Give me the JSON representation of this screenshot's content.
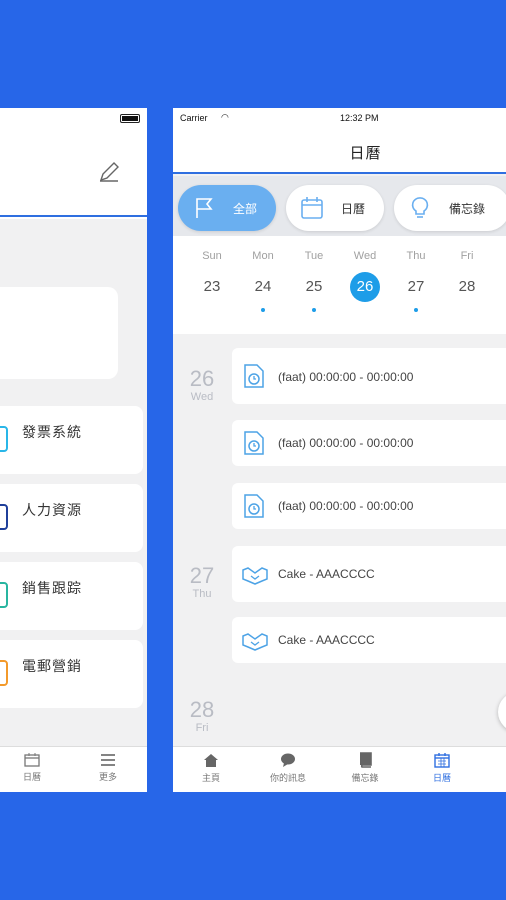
{
  "left_phone": {
    "menu_rows": [
      {
        "label": "發票系統",
        "icon": "invoice-icon",
        "color": "#29b6e8"
      },
      {
        "label": "人力資源",
        "icon": "hr-icon",
        "color": "#1f3f9a"
      },
      {
        "label": "銷售跟踪",
        "icon": "sales-icon",
        "color": "#28b5a0"
      },
      {
        "label": "電郵營銷",
        "icon": "email-icon",
        "color": "#f39a2b"
      }
    ],
    "tabs": [
      {
        "label": "日曆",
        "icon": "calendar-icon"
      },
      {
        "label": "更多",
        "icon": "menu-icon"
      }
    ]
  },
  "status_bar": {
    "carrier": "Carrier",
    "time": "12:32 PM"
  },
  "navbar": {
    "title": "日曆"
  },
  "filters": [
    {
      "label": "全部",
      "icon": "flag-icon",
      "active": true
    },
    {
      "label": "日曆",
      "icon": "calendar-icon",
      "active": false
    },
    {
      "label": "備忘錄",
      "icon": "lightbulb-icon",
      "active": false
    }
  ],
  "week": [
    {
      "name": "Sun",
      "date": "23",
      "dot": false,
      "selected": false
    },
    {
      "name": "Mon",
      "date": "24",
      "dot": true,
      "selected": false
    },
    {
      "name": "Tue",
      "date": "25",
      "dot": true,
      "selected": false
    },
    {
      "name": "Wed",
      "date": "26",
      "dot": true,
      "selected": true
    },
    {
      "name": "Thu",
      "date": "27",
      "dot": true,
      "selected": false
    },
    {
      "name": "Fri",
      "date": "28",
      "dot": false,
      "selected": false
    }
  ],
  "agenda": [
    {
      "date": "26",
      "weekday": "Wed"
    },
    {
      "date": "27",
      "weekday": "Thu"
    },
    {
      "date": "28",
      "weekday": "Fri"
    }
  ],
  "events": [
    {
      "text": "(faat) 00:00:00 - 00:00:00",
      "icon": "task-clock-icon"
    },
    {
      "text": "(faat) 00:00:00 - 00:00:00",
      "icon": "task-clock-icon"
    },
    {
      "text": "(faat) 00:00:00 - 00:00:00",
      "icon": "task-clock-icon"
    },
    {
      "text": "Cake - AAACCCC",
      "icon": "handshake-icon"
    },
    {
      "text": "Cake - AAACCCC",
      "icon": "handshake-icon"
    }
  ],
  "tabbar": [
    {
      "label": "主頁",
      "icon": "home-icon",
      "active": false
    },
    {
      "label": "你的訊息",
      "icon": "chat-icon",
      "active": false
    },
    {
      "label": "備忘錄",
      "icon": "notebook-icon",
      "active": false
    },
    {
      "label": "日曆",
      "icon": "calendar-icon",
      "active": true
    }
  ],
  "colors": {
    "background": "#2766e8",
    "accent": "#2f6fe0",
    "selected_day": "#1e9de8",
    "active_chip": "#6aaff0"
  }
}
